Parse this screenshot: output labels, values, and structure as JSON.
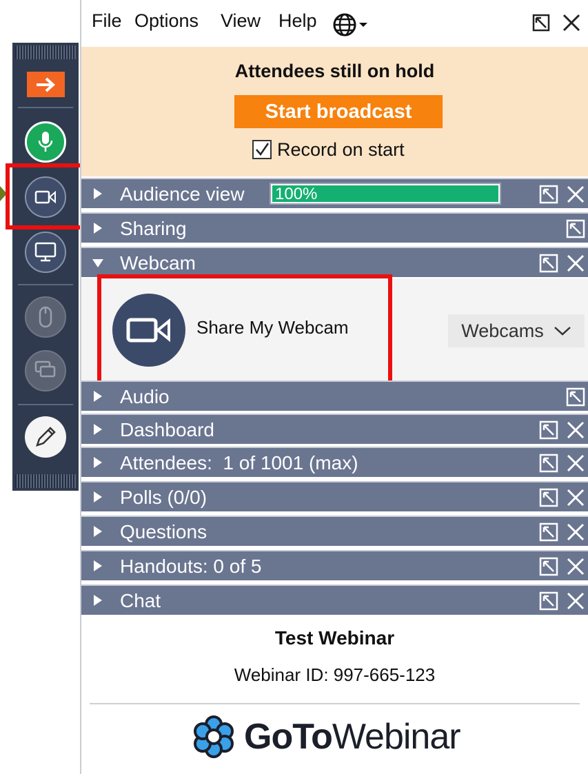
{
  "menubar": {
    "items": [
      "File",
      "Options",
      "View",
      "Help"
    ],
    "language_icon": "globe-icon",
    "popout_icon": "popout-icon",
    "close_icon": "close-icon"
  },
  "hold_banner": {
    "title": "Attendees still on hold",
    "start_button": "Start broadcast",
    "record_label": "Record on start",
    "record_checked": true
  },
  "sections": {
    "audience": {
      "label": "Audience view",
      "percent_text": "100%",
      "percent": 100
    },
    "sharing": {
      "label": "Sharing"
    },
    "webcam": {
      "label": "Webcam",
      "expanded": true
    },
    "audio": {
      "label": "Audio"
    },
    "dashboard": {
      "label": "Dashboard"
    },
    "attendees": {
      "label": "Attendees:  1 of 1001 (max)"
    },
    "polls": {
      "label": "Polls (0/0)"
    },
    "questions": {
      "label": "Questions"
    },
    "handouts": {
      "label": "Handouts: 0 of 5"
    },
    "chat": {
      "label": "Chat"
    }
  },
  "webcam_panel": {
    "share_label": "Share My Webcam",
    "dropdown_label": "Webcams"
  },
  "footer": {
    "webinar_title": "Test Webinar",
    "webinar_id": "Webinar ID: 997-665-123",
    "logo_bold": "GoTo",
    "logo_light": "Webinar"
  },
  "toolbar": {
    "icons": [
      "arrow-right-icon",
      "microphone-icon",
      "webcam-icon",
      "screen-icon",
      "mouse-icon",
      "screens-icon",
      "pencil-icon"
    ]
  },
  "colors": {
    "accent_orange": "#f7820e",
    "section_bar": "#6a7590",
    "hold_background": "#fbe3c6",
    "progress_green": "#14b072",
    "highlight_red": "#ea1010",
    "toolbar_bg": "#2f3a4e"
  }
}
